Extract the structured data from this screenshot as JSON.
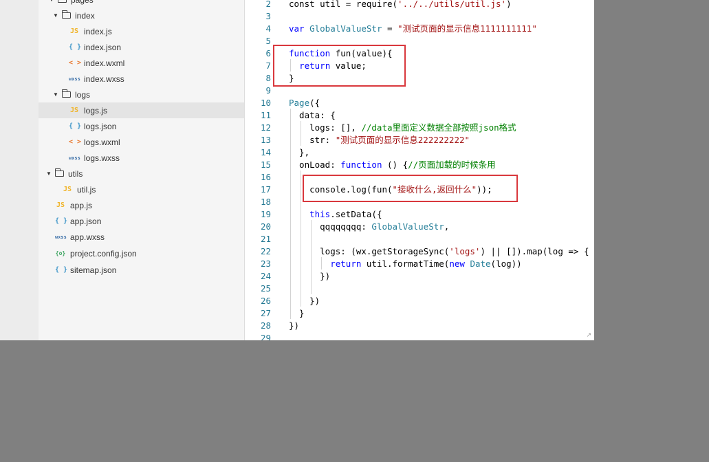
{
  "explorer": {
    "rows": [
      {
        "label": "pages",
        "icon": "folder-icon"
      },
      {
        "label": "index",
        "icon": "folder-icon"
      },
      {
        "label": "index.js",
        "icon": "js-file-icon",
        "icon_text": "JS"
      },
      {
        "label": "index.json",
        "icon": "json-file-icon",
        "icon_text": "{ }"
      },
      {
        "label": "index.wxml",
        "icon": "wxml-file-icon",
        "icon_text": "< >"
      },
      {
        "label": "index.wxss",
        "icon": "wxss-file-icon",
        "icon_text": "wxss"
      },
      {
        "label": "logs",
        "icon": "folder-icon"
      },
      {
        "label": "logs.js",
        "icon": "js-file-icon",
        "icon_text": "JS",
        "selected": true
      },
      {
        "label": "logs.json",
        "icon": "json-file-icon",
        "icon_text": "{ }"
      },
      {
        "label": "logs.wxml",
        "icon": "wxml-file-icon",
        "icon_text": "< >"
      },
      {
        "label": "logs.wxss",
        "icon": "wxss-file-icon",
        "icon_text": "wxss"
      },
      {
        "label": "utils",
        "icon": "folder-icon"
      },
      {
        "label": "util.js",
        "icon": "js-file-icon",
        "icon_text": "JS"
      },
      {
        "label": "app.js",
        "icon": "js-file-icon",
        "icon_text": "JS"
      },
      {
        "label": "app.json",
        "icon": "json-file-icon",
        "icon_text": "{ }"
      },
      {
        "label": "app.wxss",
        "icon": "wxss-file-icon",
        "icon_text": "wxss"
      },
      {
        "label": "project.config.json",
        "icon": "config-file-icon",
        "icon_text": "{o}"
      },
      {
        "label": "sitemap.json",
        "icon": "json-file-icon",
        "icon_text": "{ }"
      }
    ]
  },
  "editor": {
    "line_numbers": [
      "2",
      "3",
      "4",
      "5",
      "6",
      "7",
      "8",
      "9",
      "10",
      "11",
      "12",
      "13",
      "14",
      "15",
      "16",
      "17",
      "18",
      "19",
      "20",
      "21",
      "22",
      "23",
      "24",
      "25",
      "26",
      "27",
      "28",
      "29"
    ],
    "lines": [
      [
        {
          "t": "const util = require("
        },
        {
          "t": "'../../utils/util.js'",
          "c": "str"
        },
        {
          "t": ")"
        }
      ],
      [],
      [
        {
          "t": "var ",
          "c": "kw"
        },
        {
          "t": "GlobalValueStr",
          "c": "ty"
        },
        {
          "t": " = "
        },
        {
          "t": "\"测试页面的显示信息1111111111\"",
          "c": "str"
        }
      ],
      [],
      [
        {
          "t": "function ",
          "c": "kw"
        },
        {
          "t": "fun(value){"
        }
      ],
      [
        {
          "t": "  "
        },
        {
          "t": "return ",
          "c": "kw"
        },
        {
          "t": "value;"
        }
      ],
      [
        {
          "t": "}"
        }
      ],
      [],
      [
        {
          "t": "Page",
          "c": "ty"
        },
        {
          "t": "({"
        }
      ],
      [
        {
          "t": "  data: {"
        }
      ],
      [
        {
          "t": "    logs: [], "
        },
        {
          "t": "//data里面定义数据全部按照json格式",
          "c": "cm"
        }
      ],
      [
        {
          "t": "    str: "
        },
        {
          "t": "\"测试页面的显示信息222222222\"",
          "c": "str"
        }
      ],
      [
        {
          "t": "  },"
        }
      ],
      [
        {
          "t": "  onLoad: "
        },
        {
          "t": "function ",
          "c": "kw"
        },
        {
          "t": "() {"
        },
        {
          "t": "//页面加载的时候条用",
          "c": "cm"
        }
      ],
      [],
      [
        {
          "t": "    console.log(fun("
        },
        {
          "t": "\"接收什么,返回什么\"",
          "c": "str"
        },
        {
          "t": "));"
        }
      ],
      [],
      [
        {
          "t": "    "
        },
        {
          "t": "this",
          "c": "kw"
        },
        {
          "t": ".setData({"
        }
      ],
      [
        {
          "t": "      qqqqqqqq: "
        },
        {
          "t": "GlobalValueStr",
          "c": "ty"
        },
        {
          "t": ","
        }
      ],
      [],
      [
        {
          "t": "      logs: (wx.getStorageSync("
        },
        {
          "t": "'logs'",
          "c": "str"
        },
        {
          "t": ") || []).map(log => {"
        }
      ],
      [
        {
          "t": "        "
        },
        {
          "t": "return ",
          "c": "kw"
        },
        {
          "t": "util.formatTime("
        },
        {
          "t": "new ",
          "c": "kw"
        },
        {
          "t": "Date",
          "c": "ty"
        },
        {
          "t": "(log))"
        }
      ],
      [
        {
          "t": "      })"
        }
      ],
      [],
      [
        {
          "t": "    })"
        }
      ],
      [
        {
          "t": "  }"
        }
      ],
      [
        {
          "t": "})"
        }
      ],
      []
    ]
  },
  "icons": {
    "resize_mark": "↗"
  },
  "colors": {
    "highlight_box": "#d9383d",
    "keyword": "#0000ff",
    "string": "#a31515",
    "comment": "#008000"
  }
}
